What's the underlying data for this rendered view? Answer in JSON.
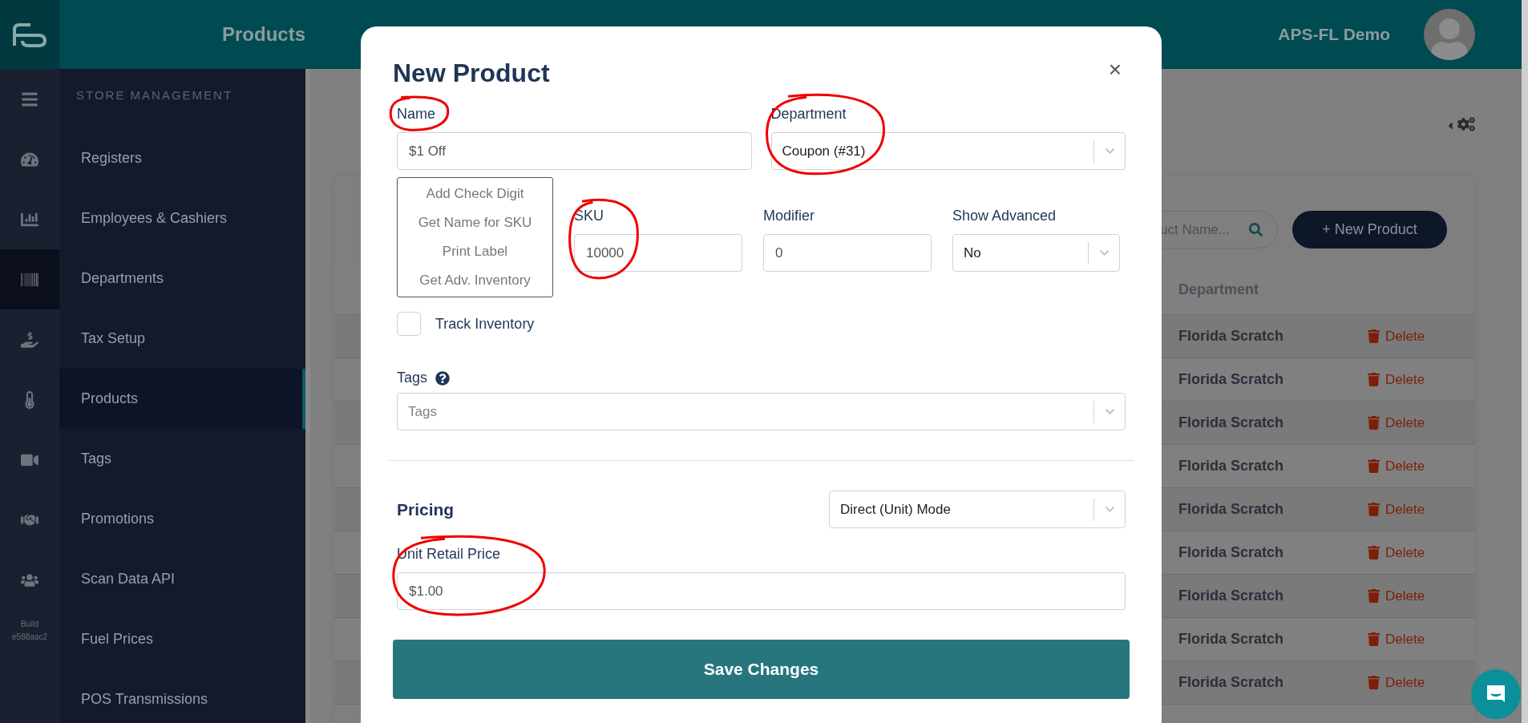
{
  "app": {
    "title": "Products",
    "account": "APS-FL Demo"
  },
  "rail": {
    "items": [
      {
        "selected": false
      },
      {
        "selected": false
      },
      {
        "selected": true
      },
      {
        "selected": false
      },
      {
        "selected": false
      },
      {
        "selected": false
      },
      {
        "selected": false
      },
      {
        "selected": false
      }
    ],
    "build_label": "Build",
    "build_id": "e588aac2"
  },
  "sidebar": {
    "section": "STORE MANAGEMENT",
    "items": [
      {
        "label": "Registers",
        "selected": false
      },
      {
        "label": "Employees & Cashiers",
        "selected": false
      },
      {
        "label": "Departments",
        "selected": false
      },
      {
        "label": "Tax Setup",
        "selected": false
      },
      {
        "label": "Products",
        "selected": true
      },
      {
        "label": "Tags",
        "selected": false
      },
      {
        "label": "Promotions",
        "selected": false
      },
      {
        "label": "Scan Data API",
        "selected": false
      },
      {
        "label": "Fuel Prices",
        "selected": false
      },
      {
        "label": "POS Transmissions",
        "selected": false
      }
    ]
  },
  "products": {
    "search": {
      "placeholder": "uct Name..."
    },
    "new_button": "+ New Product",
    "table": {
      "columns": [
        "Department"
      ],
      "rows": [
        {
          "department": "Florida Scratch",
          "action": "Delete"
        },
        {
          "department": "Florida Scratch",
          "action": "Delete"
        },
        {
          "department": "Florida Scratch",
          "action": "Delete"
        },
        {
          "department": "Florida Scratch",
          "action": "Delete"
        },
        {
          "department": "Florida Scratch",
          "action": "Delete"
        },
        {
          "department": "Florida Scratch",
          "action": "Delete"
        },
        {
          "department": "Florida Scratch",
          "action": "Delete"
        },
        {
          "department": "Florida Scratch",
          "action": "Delete"
        },
        {
          "department": "Florida Scratch",
          "action": "Delete"
        }
      ]
    }
  },
  "modal": {
    "title": "New Product",
    "close": "×",
    "name": {
      "label": "Name",
      "value": "$1 Off"
    },
    "department": {
      "label": "Department",
      "value": "Coupon (#31)"
    },
    "sku_actions": [
      "Add Check Digit",
      "Get Name for SKU",
      "Print Label",
      "Get Adv. Inventory"
    ],
    "sku": {
      "label": "SKU",
      "value": "10000"
    },
    "modifier": {
      "label": "Modifier",
      "value": "0"
    },
    "show_advanced": {
      "label": "Show Advanced",
      "value": "No"
    },
    "track_inventory": {
      "label": "Track Inventory",
      "checked": false
    },
    "tags": {
      "label": "Tags",
      "placeholder": "Tags"
    },
    "pricing": {
      "label": "Pricing",
      "mode": "Direct (Unit) Mode"
    },
    "unit_retail_price": {
      "label": "Unit Retail Price",
      "value": "$1.00"
    },
    "save": "Save Changes"
  }
}
